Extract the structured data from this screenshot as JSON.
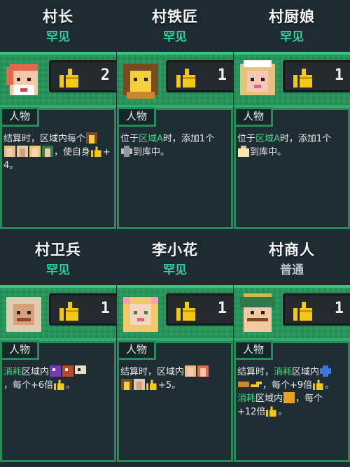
{
  "cards": [
    {
      "name": "村长",
      "rarity": "罕见",
      "rarity_type": "rare",
      "count": "2",
      "tag": "人物",
      "desc": [
        "结算时，区域内每个",
        "，使自身",
        "+4。"
      ],
      "palette": {
        "hair": "#e06a4e",
        "skin": "#f7c8a8",
        "extra": "#ffffff"
      }
    },
    {
      "name": "村铁匠",
      "rarity": "罕见",
      "rarity_type": "rare",
      "count": "1",
      "tag": "人物",
      "desc": [
        "位于",
        "区域A",
        "时，添加1个",
        "到库中。"
      ],
      "palette": {
        "hair": "#7a4a22",
        "skin": "#f4d03a",
        "extra": "#c98a2e"
      }
    },
    {
      "name": "村厨娘",
      "rarity": "罕见",
      "rarity_type": "rare",
      "count": "1",
      "tag": "人物",
      "desc": [
        "位于",
        "区域A",
        "时，添加1个",
        "到库中。"
      ],
      "palette": {
        "hair": "#e6c27c",
        "skin": "#f7c8b8",
        "extra": "#ffffff"
      }
    },
    {
      "name": "村卫兵",
      "rarity": "罕见",
      "rarity_type": "rare",
      "count": "1",
      "tag": "人物",
      "desc": [
        "消耗",
        "区域内",
        "，每个+6倍",
        "。"
      ],
      "palette": {
        "hair": "#dccdb0",
        "skin": "#d9a07a",
        "extra": "#b0a080"
      }
    },
    {
      "name": "李小花",
      "rarity": "罕见",
      "rarity_type": "rare",
      "count": "1",
      "tag": "人物",
      "desc": [
        "结算时，区域内",
        "+5。"
      ],
      "palette": {
        "hair": "#f2c96a",
        "skin": "#f7d6c0",
        "extra": "#ff9ab8"
      }
    },
    {
      "name": "村商人",
      "rarity": "普通",
      "rarity_type": "common",
      "count": "1",
      "tag": "人物",
      "desc": [
        "结算时，",
        "消耗",
        "区域内",
        "，每个+9倍",
        "。",
        "消耗",
        "区域内",
        "，每个",
        "+12倍",
        "。"
      ],
      "palette": {
        "hair": "#2e7a4e",
        "skin": "#f2c9a0",
        "extra": "#d9b24a"
      }
    }
  ]
}
